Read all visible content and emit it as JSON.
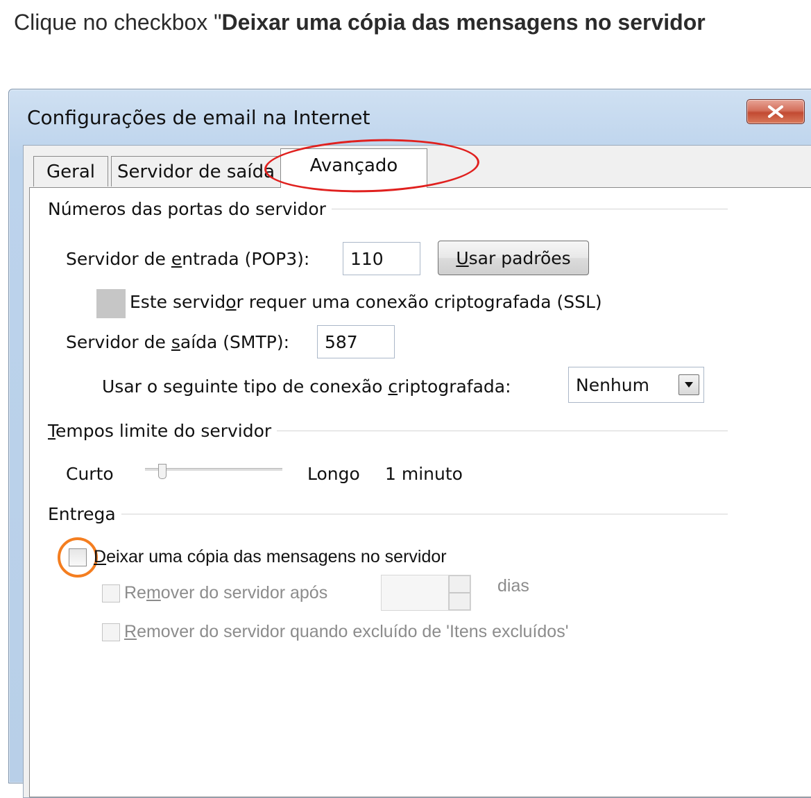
{
  "instruction": {
    "prefix": "Clique no checkbox \"",
    "bold": "Deixar uma cópia das mensagens no servidor"
  },
  "window": {
    "title": "Configurações de email na Internet",
    "close_label": "X"
  },
  "tabs": [
    {
      "label": "Geral",
      "active": false
    },
    {
      "label": "Servidor de saída",
      "active": false
    },
    {
      "label": "Avançado",
      "active": true
    }
  ],
  "ports_group": {
    "title": "Números das portas do servidor",
    "incoming_label_pre": "Servidor de ",
    "incoming_label_u": "e",
    "incoming_label_post": "ntrada (POP3):",
    "incoming_value": "110",
    "defaults_button_u": "U",
    "defaults_button_rest": "sar padrões",
    "ssl_label_pre": "Este servid",
    "ssl_label_u": "o",
    "ssl_label_post": "r requer uma conexão criptografada (SSL)",
    "outgoing_label_pre": "Servidor de ",
    "outgoing_label_u": "s",
    "outgoing_label_post": "aída (SMTP):",
    "outgoing_value": "587",
    "encryption_label_pre": "Usar o seguinte tipo de conexão ",
    "encryption_label_u": "c",
    "encryption_label_post": "riptografada:",
    "encryption_value": "Nenhum"
  },
  "timeout_group": {
    "title_u": "T",
    "title_rest": "empos limite do servidor",
    "short_label": "Curto",
    "long_label": "Longo",
    "value": "1 minuto",
    "slider_level": 0.1
  },
  "delivery_group": {
    "title": "Entrega",
    "leave_copy_u": "D",
    "leave_copy_rest": "eixar uma cópia das mensagens no servidor",
    "remove_after_pre": "Re",
    "remove_after_u": "m",
    "remove_after_post": "over do servidor após",
    "days_label": "dias",
    "remove_deleted_u": "R",
    "remove_deleted_rest": "emover do servidor quando excluído de 'Itens excluídos'"
  },
  "colors": {
    "tab_highlight": "#e0201e",
    "checkbox_highlight": "#f47e20"
  }
}
